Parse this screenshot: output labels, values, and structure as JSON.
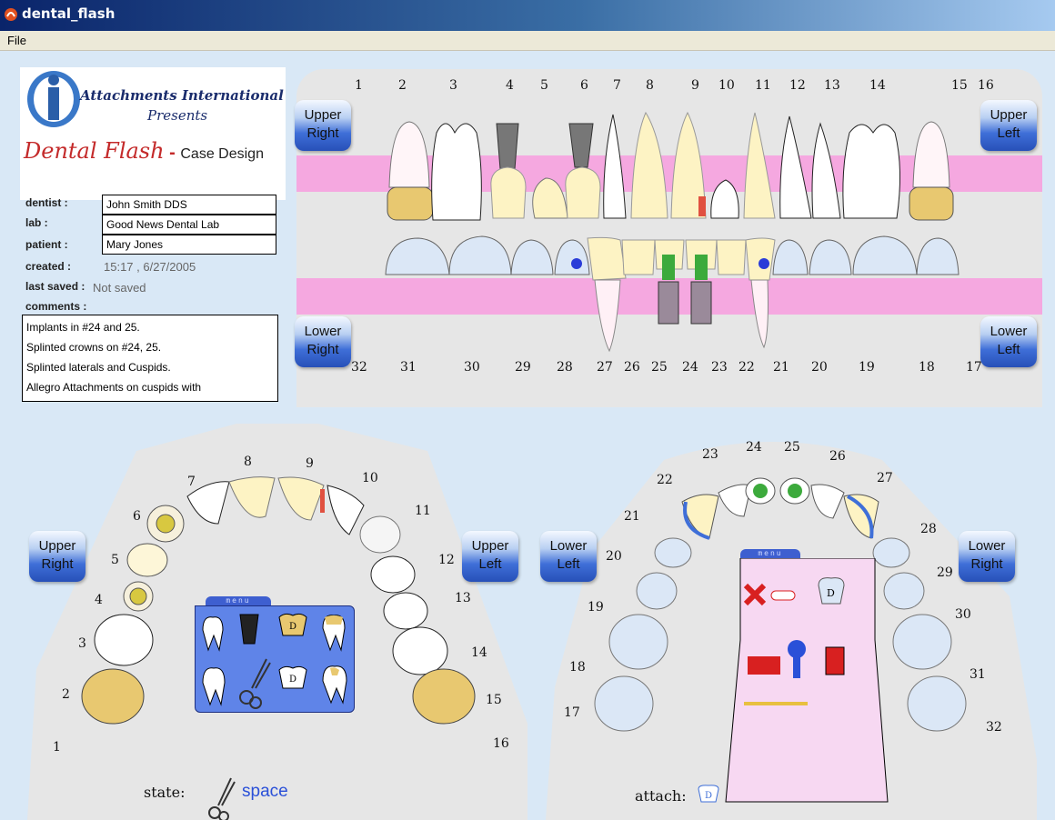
{
  "window": {
    "title": "dental_flash"
  },
  "menubar": {
    "file_label": "File"
  },
  "logo": {
    "company": "Attachments International",
    "presents": "Presents",
    "product": "Dental Flash",
    "separator": " - ",
    "subtitle": "Case Design"
  },
  "case_info": {
    "dentist_label": "dentist :",
    "dentist_value": "John Smith DDS",
    "lab_label": "lab :",
    "lab_value": "Good News Dental Lab",
    "patient_label": "patient :",
    "patient_value": "Mary Jones",
    "created_label": "created :",
    "created_value": "15:17 , 6/27/2005",
    "last_saved_label": "last saved :",
    "last_saved_value": "Not saved",
    "comments_label": "comments :",
    "comments_lines": [
      "Implants in #24 and 25.",
      "Splinted crowns on #24, 25.",
      "Splinted laterals and Cuspids.",
      "Allegro Attachments on cuspids with"
    ]
  },
  "nav_buttons": {
    "upper": "Upper",
    "lower": "Lower",
    "right": "Right",
    "left": "Left"
  },
  "tooth_numbers": {
    "upper": [
      "1",
      "2",
      "3",
      "4",
      "5",
      "6",
      "7",
      "8",
      "9",
      "10",
      "11",
      "12",
      "13",
      "14",
      "15",
      "16"
    ],
    "lower": [
      "32",
      "31",
      "30",
      "29",
      "28",
      "27",
      "26",
      "25",
      "24",
      "23",
      "22",
      "21",
      "20",
      "19",
      "18",
      "17"
    ]
  },
  "menus": {
    "tab_label": "menu"
  },
  "status": {
    "state_label": "state:",
    "state_value": "space",
    "attach_label": "attach:",
    "attach_icon_letter": "D"
  },
  "lower_menu": {
    "crown_letter": "D"
  },
  "upper_menu": {
    "crown_letter": "D"
  },
  "colors": {
    "gold": "#e8c870",
    "pink_gum": "#f5a8e0",
    "panel_bg": "#e6e6e6",
    "stage_bg": "#d9e8f6",
    "accent_blue": "#3f6fd8",
    "red_marker": "#e05040"
  }
}
